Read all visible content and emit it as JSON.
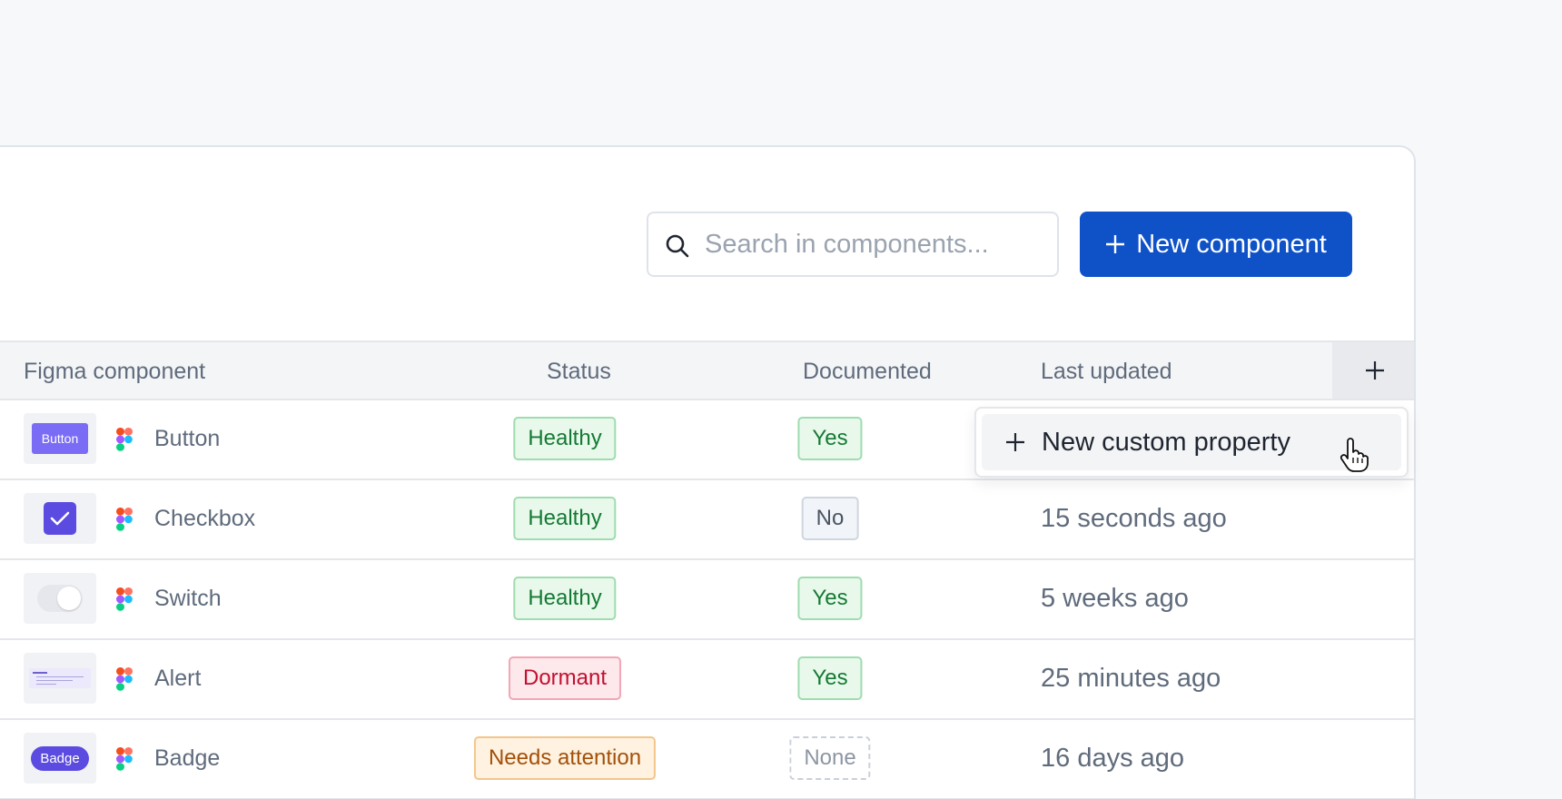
{
  "search": {
    "placeholder": "Search in components..."
  },
  "toolbar": {
    "new_component_label": "New component"
  },
  "table": {
    "headers": {
      "component": "Figma component",
      "status": "Status",
      "documented": "Documented",
      "updated": "Last updated"
    },
    "rows": [
      {
        "thumb_label": "Button",
        "name": "Button",
        "status": "Healthy",
        "documented": "Yes",
        "updated": ""
      },
      {
        "thumb_label": "",
        "name": "Checkbox",
        "status": "Healthy",
        "documented": "No",
        "updated": "15 seconds ago"
      },
      {
        "thumb_label": "",
        "name": "Switch",
        "status": "Healthy",
        "documented": "Yes",
        "updated": "5 weeks ago"
      },
      {
        "thumb_label": "",
        "name": "Alert",
        "status": "Dormant",
        "documented": "Yes",
        "updated": "25 minutes ago"
      },
      {
        "thumb_label": "Badge",
        "name": "Badge",
        "status": "Needs attention",
        "documented": "None",
        "updated": "16 days ago"
      }
    ]
  },
  "dropdown": {
    "new_custom_property_label": "New custom property"
  },
  "colors": {
    "primary": "#0f52c8",
    "healthy": "#157a33",
    "dormant": "#c2102f",
    "needs_attention": "#a4500a",
    "thumbnail_accent": "#6c5ce7"
  },
  "icons": {
    "search": "search-icon",
    "add": "plus-icon",
    "figma": "figma-icon",
    "check": "check-icon",
    "cursor": "pointer-hand-icon"
  }
}
